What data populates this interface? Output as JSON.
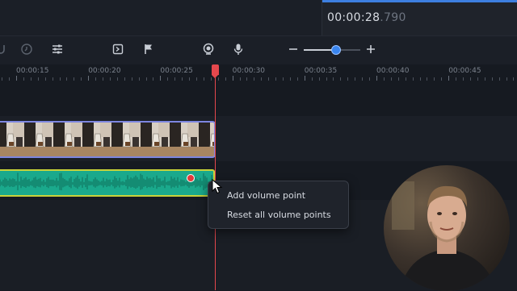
{
  "preview": {
    "timecode_main": "00:00:28",
    "timecode_frac": ".790"
  },
  "toolbar": {
    "icons": [
      "snap-icon",
      "speed-icon",
      "adjust-icon",
      "crop-icon",
      "marker-flag-icon",
      "record-icon",
      "microphone-icon"
    ],
    "zoom_out_icon": "minus-icon",
    "zoom_in_icon": "plus-icon",
    "zoom_level": 0.55
  },
  "ruler": {
    "labels": [
      "00:00:15",
      "00:00:20",
      "00:00:25",
      "00:00:30",
      "00:00:35",
      "00:00:40",
      "00:00:45"
    ]
  },
  "timeline": {
    "playhead_time": "00:00:28.790"
  },
  "context_menu": {
    "items": [
      "Add volume point",
      "Reset all volume points"
    ]
  },
  "colors": {
    "accent": "#3a86f0",
    "playhead": "#e5484d",
    "audio_clip": "#1aa98c",
    "video_clip_border": "#7d86e0",
    "volume_point": "#e23b3b"
  }
}
